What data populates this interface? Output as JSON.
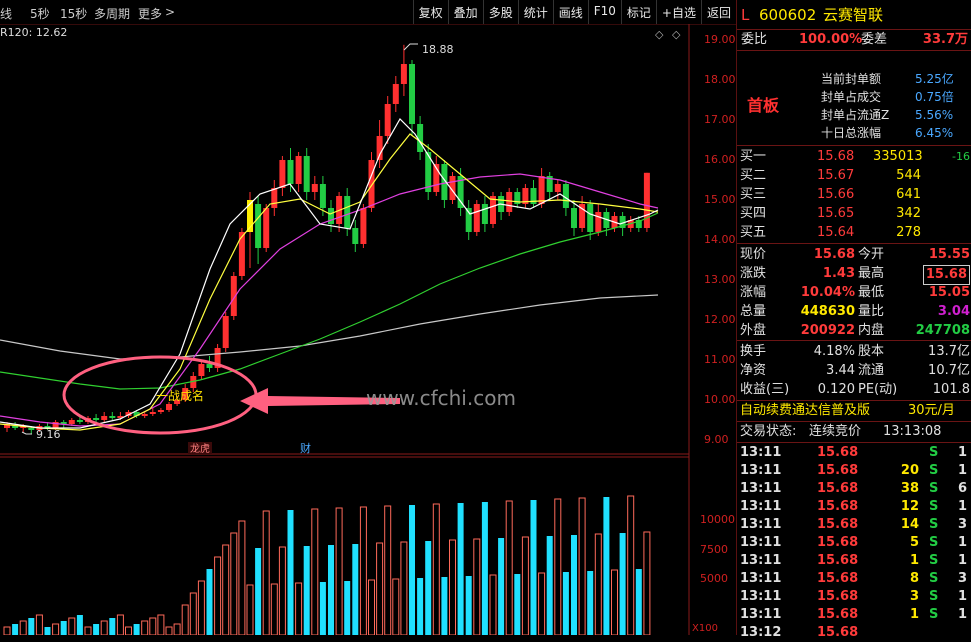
{
  "topbar": {
    "tabs": [
      "线",
      "5秒",
      "15秒",
      "多周期",
      "更多"
    ],
    "more_arrow": ">",
    "tools": [
      "复权",
      "叠加",
      "多股",
      "统计",
      "画线",
      "F10",
      "标记",
      "+自选",
      "返回"
    ]
  },
  "chart": {
    "ma_label": "R120: 12.62",
    "high_label": "18.88",
    "low_label": "9.16",
    "annotation": "一战成名",
    "watermark": "www.cfchi.com",
    "tag_longhu": "龙虎",
    "tag_cai": "财",
    "price_ticks": [
      "19.00",
      "18.00",
      "17.00",
      "16.00",
      "15.00",
      "14.00",
      "13.00",
      "12.00",
      "11.00",
      "10.00",
      "9.00"
    ],
    "volume_ticks": [
      "10000",
      "7500",
      "5000"
    ],
    "volume_unit": "X100",
    "colors": {
      "up": "#ff3030",
      "down": "#20e0ff",
      "ma5": "#ffffff",
      "ma10": "#ffff40",
      "ma20": "#e040e0",
      "ma60": "#30d030",
      "ma120": "#c8c8c8",
      "highlight": "#ff5070"
    }
  },
  "quote": {
    "flag": "L",
    "code": "600602",
    "name": "云赛智联",
    "weibi_label": "委比",
    "weibi_value": "100.00%",
    "weicha_label": "委差",
    "weicha_value": "33.7万",
    "board_label": "首板",
    "info": [
      {
        "label": "当前封单额",
        "value": "5.25亿"
      },
      {
        "label": "封单占成交",
        "value": "0.75倍"
      },
      {
        "label": "封单占流通Z",
        "value": "5.56%"
      },
      {
        "label": "十日总涨幅",
        "value": "6.45%"
      }
    ],
    "orderbook": [
      {
        "label": "买一",
        "price": "15.68",
        "vol": "335013",
        "chg": "-16"
      },
      {
        "label": "买二",
        "price": "15.67",
        "vol": "544",
        "chg": ""
      },
      {
        "label": "买三",
        "price": "15.66",
        "vol": "641",
        "chg": ""
      },
      {
        "label": "买四",
        "price": "15.65",
        "vol": "342",
        "chg": ""
      },
      {
        "label": "买五",
        "price": "15.64",
        "vol": "278",
        "chg": ""
      }
    ],
    "stats": [
      {
        "l1": "现价",
        "v1": "15.68",
        "l2": "今开",
        "v2": "15.55"
      },
      {
        "l1": "涨跌",
        "v1": "1.43",
        "l2": "最高",
        "v2": "15.68"
      },
      {
        "l1": "涨幅",
        "v1": "10.04%",
        "l2": "最低",
        "v2": "15.05"
      },
      {
        "l1": "总量",
        "v1": "448630",
        "l2": "量比",
        "v2": "3.04"
      },
      {
        "l1": "外盘",
        "v1": "200922",
        "l2": "内盘",
        "v2": "247708"
      }
    ],
    "fundamentals": [
      {
        "l1": "换手",
        "v1": "4.18%",
        "l2": "股本",
        "v2": "13.7亿"
      },
      {
        "l1": "净资",
        "v1": "3.44",
        "l2": "流通",
        "v2": "10.7亿"
      },
      {
        "l1": "收益(三)",
        "v1": "0.120",
        "l2": "PE(动)",
        "v2": "101.8"
      }
    ],
    "promo_text": "自动续费通达信普及版",
    "promo_price": "30元/月",
    "status_label": "交易状态:",
    "status_value": "连续竞价",
    "status_time": "13:13:08",
    "ticks": [
      {
        "time": "13:11",
        "price": "15.68",
        "vol": "",
        "side": "S",
        "n": "1"
      },
      {
        "time": "13:11",
        "price": "15.68",
        "vol": "20",
        "side": "S",
        "n": "1"
      },
      {
        "time": "13:11",
        "price": "15.68",
        "vol": "38",
        "side": "S",
        "n": "6"
      },
      {
        "time": "13:11",
        "price": "15.68",
        "vol": "12",
        "side": "S",
        "n": "1"
      },
      {
        "time": "13:11",
        "price": "15.68",
        "vol": "14",
        "side": "S",
        "n": "3"
      },
      {
        "time": "13:11",
        "price": "15.68",
        "vol": "5",
        "side": "S",
        "n": "1"
      },
      {
        "time": "13:11",
        "price": "15.68",
        "vol": "1",
        "side": "S",
        "n": "1"
      },
      {
        "time": "13:11",
        "price": "15.68",
        "vol": "8",
        "side": "S",
        "n": "3"
      },
      {
        "time": "13:11",
        "price": "15.68",
        "vol": "3",
        "side": "S",
        "n": "1"
      },
      {
        "time": "13:11",
        "price": "15.68",
        "vol": "1",
        "side": "S",
        "n": "1"
      },
      {
        "time": "13:12",
        "price": "15.68",
        "vol": "",
        "side": "",
        "n": ""
      }
    ]
  }
}
